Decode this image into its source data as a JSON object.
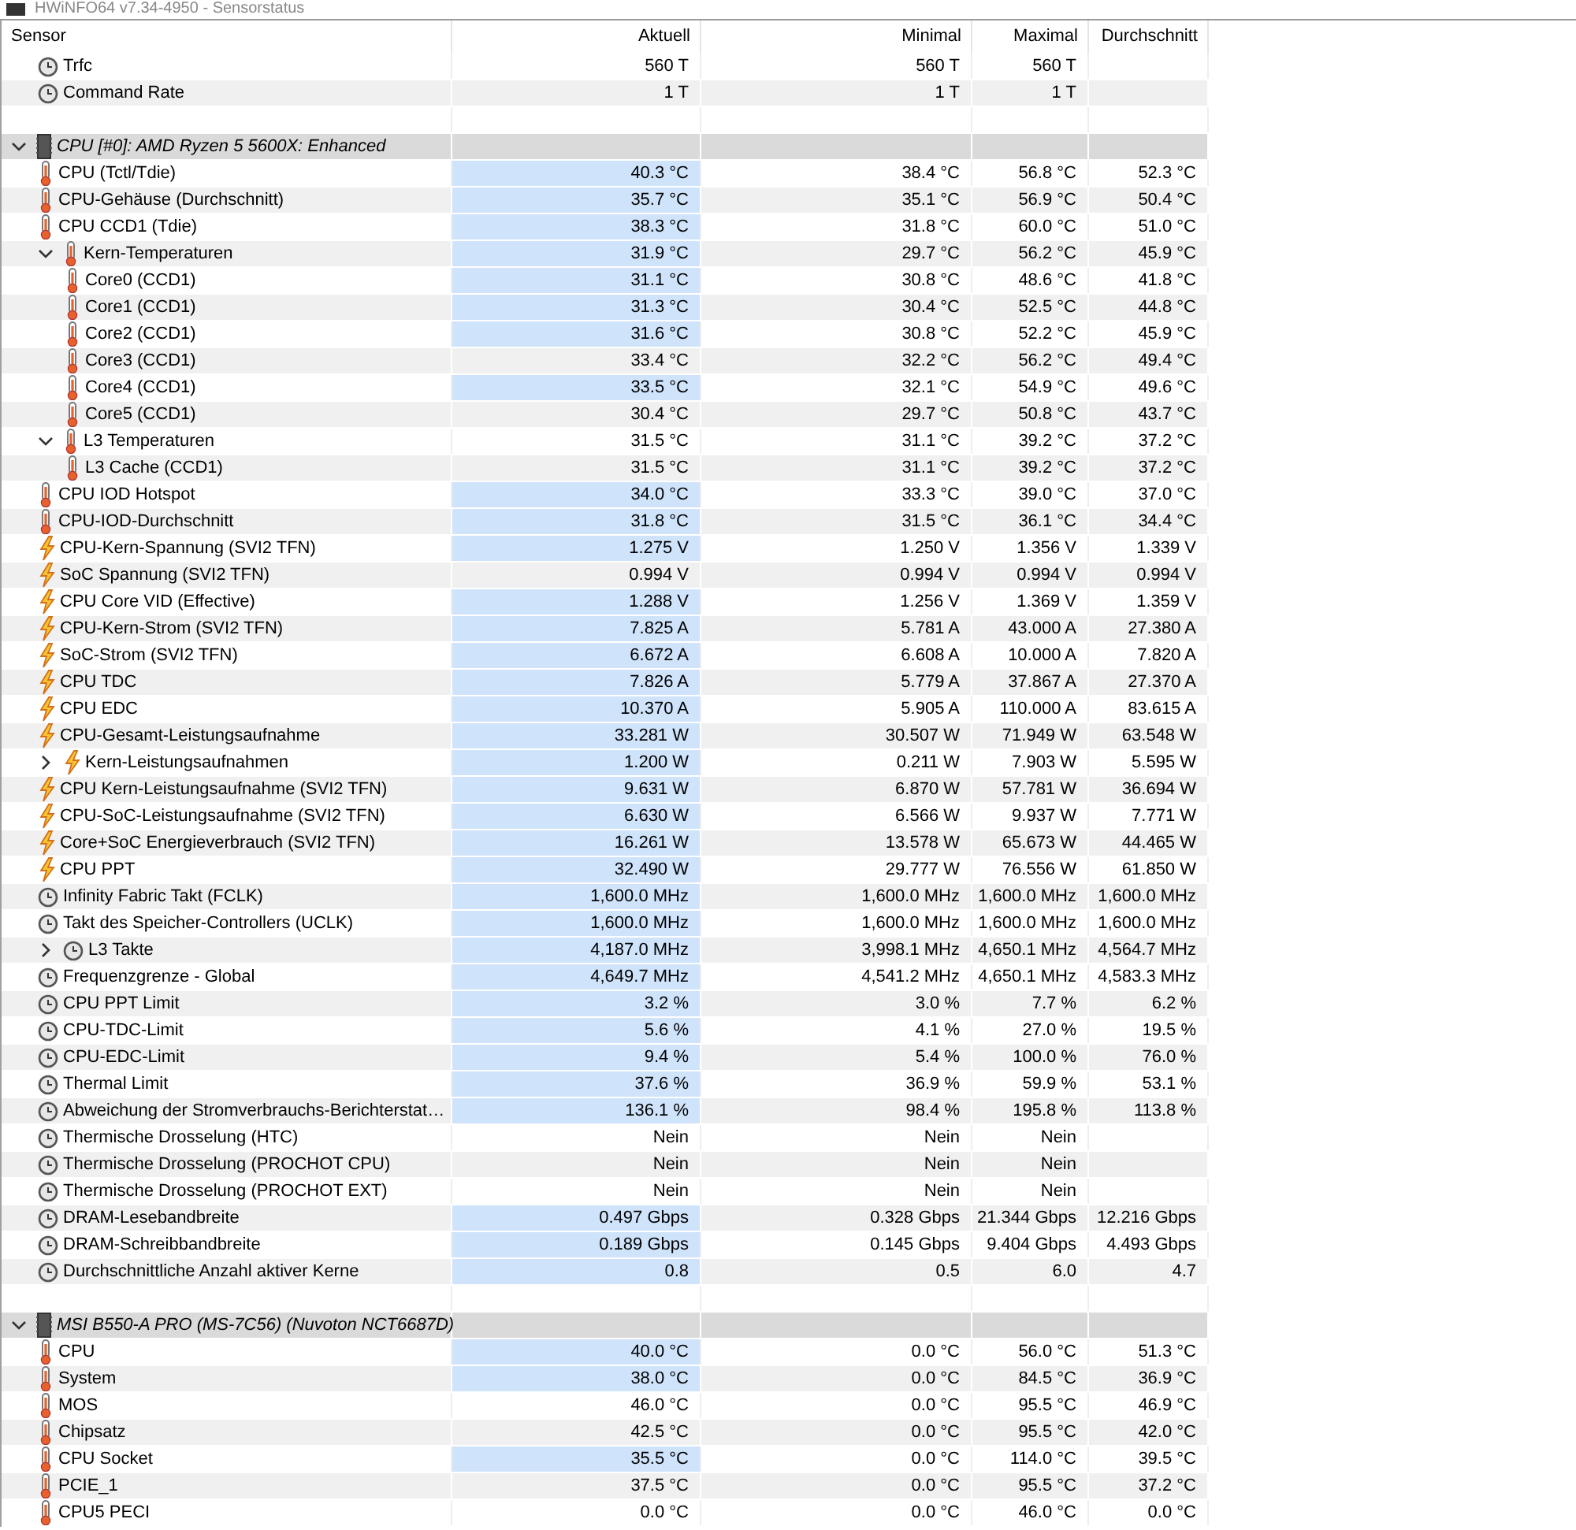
{
  "window": {
    "title": "HWiNFO64 v7.34-4950 - Sensorstatus"
  },
  "table": {
    "columns": [
      "Sensor",
      "Aktuell",
      "Minimal",
      "Maximal",
      "Durchschnitt"
    ],
    "rows": [
      {
        "kind": "clock",
        "name": "Trfc",
        "now": "560 T",
        "min": "560 T",
        "max": "560 T",
        "highlighted": false
      },
      {
        "kind": "clock",
        "name": "Command Rate",
        "now": "1 T",
        "min": "1 T",
        "max": "1 T",
        "highlighted": false
      },
      {
        "kind": "blank"
      },
      {
        "kind": "device",
        "name": "CPU [#0]: AMD Ryzen 5 5600X: Enhanced",
        "expanded": true,
        "children": [
          {
            "kind": "thermo",
            "name": "CPU (Tctl/Tdie)",
            "now": "40.3 °C",
            "min": "38.4 °C",
            "max": "56.8 °C",
            "avg": "52.3 °C",
            "highlighted": true
          },
          {
            "kind": "thermo",
            "name": "CPU-Gehäuse (Durchschnitt)",
            "now": "35.7 °C",
            "min": "35.1 °C",
            "max": "56.9 °C",
            "avg": "50.4 °C",
            "highlighted": true
          },
          {
            "kind": "thermo",
            "name": "CPU CCD1 (Tdie)",
            "now": "38.3 °C",
            "min": "31.8 °C",
            "max": "60.0 °C",
            "avg": "51.0 °C",
            "highlighted": true
          },
          {
            "kind": "thermo",
            "name": "Kern-Temperaturen",
            "now": "31.9 °C",
            "min": "29.7 °C",
            "max": "56.2 °C",
            "avg": "45.9 °C",
            "highlighted": true,
            "expanded": true,
            "children": [
              {
                "kind": "thermo",
                "name": "Core0 (CCD1)",
                "now": "31.1 °C",
                "min": "30.8 °C",
                "max": "48.6 °C",
                "avg": "41.8 °C",
                "highlighted": true
              },
              {
                "kind": "thermo",
                "name": "Core1 (CCD1)",
                "now": "31.3 °C",
                "min": "30.4 °C",
                "max": "52.5 °C",
                "avg": "44.8 °C",
                "highlighted": true
              },
              {
                "kind": "thermo",
                "name": "Core2 (CCD1)",
                "now": "31.6 °C",
                "min": "30.8 °C",
                "max": "52.2 °C",
                "avg": "45.9 °C",
                "highlighted": true
              },
              {
                "kind": "thermo",
                "name": "Core3 (CCD1)",
                "now": "33.4 °C",
                "min": "32.2 °C",
                "max": "56.2 °C",
                "avg": "49.4 °C",
                "highlighted": false
              },
              {
                "kind": "thermo",
                "name": "Core4 (CCD1)",
                "now": "33.5 °C",
                "min": "32.1 °C",
                "max": "54.9 °C",
                "avg": "49.6 °C",
                "highlighted": true
              },
              {
                "kind": "thermo",
                "name": "Core5 (CCD1)",
                "now": "30.4 °C",
                "min": "29.7 °C",
                "max": "50.8 °C",
                "avg": "43.7 °C",
                "highlighted": false
              }
            ]
          },
          {
            "kind": "thermo",
            "name": "L3 Temperaturen",
            "now": "31.5 °C",
            "min": "31.1 °C",
            "max": "39.2 °C",
            "avg": "37.2 °C",
            "highlighted": false,
            "expanded": true,
            "children": [
              {
                "kind": "thermo",
                "name": "L3 Cache (CCD1)",
                "now": "31.5 °C",
                "min": "31.1 °C",
                "max": "39.2 °C",
                "avg": "37.2 °C",
                "highlighted": false
              }
            ]
          },
          {
            "kind": "thermo",
            "name": "CPU IOD Hotspot",
            "now": "34.0 °C",
            "min": "33.3 °C",
            "max": "39.0 °C",
            "avg": "37.0 °C",
            "highlighted": true
          },
          {
            "kind": "thermo",
            "name": "CPU-IOD-Durchschnitt",
            "now": "31.8 °C",
            "min": "31.5 °C",
            "max": "36.1 °C",
            "avg": "34.4 °C",
            "highlighted": true
          },
          {
            "kind": "power",
            "name": "CPU-Kern-Spannung (SVI2 TFN)",
            "now": "1.275 V",
            "min": "1.250 V",
            "max": "1.356 V",
            "avg": "1.339 V",
            "highlighted": true
          },
          {
            "kind": "power",
            "name": "SoC Spannung (SVI2 TFN)",
            "now": "0.994 V",
            "min": "0.994 V",
            "max": "0.994 V",
            "avg": "0.994 V",
            "highlighted": false
          },
          {
            "kind": "power",
            "name": "CPU Core VID (Effective)",
            "now": "1.288 V",
            "min": "1.256 V",
            "max": "1.369 V",
            "avg": "1.359 V",
            "highlighted": true
          },
          {
            "kind": "power",
            "name": "CPU-Kern-Strom (SVI2 TFN)",
            "now": "7.825 A",
            "min": "5.781 A",
            "max": "43.000 A",
            "avg": "27.380 A",
            "highlighted": true
          },
          {
            "kind": "power",
            "name": "SoC-Strom (SVI2 TFN)",
            "now": "6.672 A",
            "min": "6.608 A",
            "max": "10.000 A",
            "avg": "7.820 A",
            "highlighted": true
          },
          {
            "kind": "power",
            "name": "CPU TDC",
            "now": "7.826 A",
            "min": "5.779 A",
            "max": "37.867 A",
            "avg": "27.370 A",
            "highlighted": true
          },
          {
            "kind": "power",
            "name": "CPU EDC",
            "now": "10.370 A",
            "min": "5.905 A",
            "max": "110.000 A",
            "avg": "83.615 A",
            "highlighted": true
          },
          {
            "kind": "power",
            "name": "CPU-Gesamt-Leistungsaufnahme",
            "now": "33.281 W",
            "min": "30.507 W",
            "max": "71.949 W",
            "avg": "63.548 W",
            "highlighted": true
          },
          {
            "kind": "power",
            "name": "Kern-Leistungsaufnahmen",
            "now": "1.200 W",
            "min": "0.211 W",
            "max": "7.903 W",
            "avg": "5.595 W",
            "highlighted": true,
            "expanded": false
          },
          {
            "kind": "power",
            "name": "CPU Kern-Leistungsaufnahme (SVI2 TFN)",
            "now": "9.631 W",
            "min": "6.870 W",
            "max": "57.781 W",
            "avg": "36.694 W",
            "highlighted": true
          },
          {
            "kind": "power",
            "name": "CPU-SoC-Leistungsaufnahme (SVI2 TFN)",
            "now": "6.630 W",
            "min": "6.566 W",
            "max": "9.937 W",
            "avg": "7.771 W",
            "highlighted": true
          },
          {
            "kind": "power",
            "name": "Core+SoC Energieverbrauch (SVI2 TFN)",
            "now": "16.261 W",
            "min": "13.578 W",
            "max": "65.673 W",
            "avg": "44.465 W",
            "highlighted": true
          },
          {
            "kind": "power",
            "name": "CPU PPT",
            "now": "32.490 W",
            "min": "29.777 W",
            "max": "76.556 W",
            "avg": "61.850 W",
            "highlighted": true
          },
          {
            "kind": "clock",
            "name": "Infinity Fabric Takt (FCLK)",
            "now": "1,600.0 MHz",
            "min": "1,600.0 MHz",
            "max": "1,600.0 MHz",
            "avg": "1,600.0 MHz",
            "highlighted": true
          },
          {
            "kind": "clock",
            "name": "Takt des Speicher-Controllers (UCLK)",
            "now": "1,600.0 MHz",
            "min": "1,600.0 MHz",
            "max": "1,600.0 MHz",
            "avg": "1,600.0 MHz",
            "highlighted": true
          },
          {
            "kind": "clock",
            "name": "L3 Takte",
            "now": "4,187.0 MHz",
            "min": "3,998.1 MHz",
            "max": "4,650.1 MHz",
            "avg": "4,564.7 MHz",
            "highlighted": true,
            "expanded": false
          },
          {
            "kind": "clock",
            "name": "Frequenzgrenze - Global",
            "now": "4,649.7 MHz",
            "min": "4,541.2 MHz",
            "max": "4,650.1 MHz",
            "avg": "4,583.3 MHz",
            "highlighted": true
          },
          {
            "kind": "clock",
            "name": "CPU PPT Limit",
            "now": "3.2 %",
            "min": "3.0 %",
            "max": "7.7 %",
            "avg": "6.2 %",
            "highlighted": true
          },
          {
            "kind": "clock",
            "name": "CPU-TDC-Limit",
            "now": "5.6 %",
            "min": "4.1 %",
            "max": "27.0 %",
            "avg": "19.5 %",
            "highlighted": true
          },
          {
            "kind": "clock",
            "name": "CPU-EDC-Limit",
            "now": "9.4 %",
            "min": "5.4 %",
            "max": "100.0 %",
            "avg": "76.0 %",
            "highlighted": true
          },
          {
            "kind": "clock",
            "name": "Thermal Limit",
            "now": "37.6 %",
            "min": "36.9 %",
            "max": "59.9 %",
            "avg": "53.1 %",
            "highlighted": true
          },
          {
            "kind": "clock",
            "name": "Abweichung der Stromverbrauchs-Berichterstat…",
            "now": "136.1 %",
            "min": "98.4 %",
            "max": "195.8 %",
            "avg": "113.8 %",
            "highlighted": true
          },
          {
            "kind": "clock",
            "name": "Thermische Drosselung (HTC)",
            "now": "Nein",
            "min": "Nein",
            "max": "Nein",
            "highlighted": false
          },
          {
            "kind": "clock",
            "name": "Thermische Drosselung (PROCHOT CPU)",
            "now": "Nein",
            "min": "Nein",
            "max": "Nein",
            "highlighted": false
          },
          {
            "kind": "clock",
            "name": "Thermische Drosselung (PROCHOT EXT)",
            "now": "Nein",
            "min": "Nein",
            "max": "Nein",
            "highlighted": false
          },
          {
            "kind": "clock",
            "name": "DRAM-Lesebandbreite",
            "now": "0.497 Gbps",
            "min": "0.328 Gbps",
            "max": "21.344 Gbps",
            "avg": "12.216 Gbps",
            "highlighted": true
          },
          {
            "kind": "clock",
            "name": "DRAM-Schreibbandbreite",
            "now": "0.189 Gbps",
            "min": "0.145 Gbps",
            "max": "9.404 Gbps",
            "avg": "4.493 Gbps",
            "highlighted": true
          },
          {
            "kind": "clock",
            "name": "Durchschnittliche Anzahl aktiver Kerne",
            "now": "0.8",
            "min": "0.5",
            "max": "6.0",
            "avg": "4.7",
            "highlighted": true
          }
        ]
      },
      {
        "kind": "blank"
      },
      {
        "kind": "device",
        "name": "MSI B550-A PRO (MS-7C56) (Nuvoton NCT6687D)",
        "expanded": true,
        "children": [
          {
            "kind": "thermo",
            "name": "CPU",
            "now": "40.0 °C",
            "min": "0.0 °C",
            "max": "56.0 °C",
            "avg": "51.3 °C",
            "highlighted": true
          },
          {
            "kind": "thermo",
            "name": "System",
            "now": "38.0 °C",
            "min": "0.0 °C",
            "max": "84.5 °C",
            "avg": "36.9 °C",
            "highlighted": true
          },
          {
            "kind": "thermo",
            "name": "MOS",
            "now": "46.0 °C",
            "min": "0.0 °C",
            "max": "95.5 °C",
            "avg": "46.9 °C",
            "highlighted": false
          },
          {
            "kind": "thermo",
            "name": "Chipsatz",
            "now": "42.5 °C",
            "min": "0.0 °C",
            "max": "95.5 °C",
            "avg": "42.0 °C",
            "highlighted": false
          },
          {
            "kind": "thermo",
            "name": "CPU Socket",
            "now": "35.5 °C",
            "min": "0.0 °C",
            "max": "114.0 °C",
            "avg": "39.5 °C",
            "highlighted": true
          },
          {
            "kind": "thermo",
            "name": "PCIE_1",
            "now": "37.5 °C",
            "min": "0.0 °C",
            "max": "95.5 °C",
            "avg": "37.2 °C",
            "highlighted": false
          },
          {
            "kind": "thermo",
            "name": "CPU5 PECI",
            "now": "0.0 °C",
            "min": "0.0 °C",
            "max": "46.0 °C",
            "avg": "0.0 °C",
            "highlighted": false
          }
        ]
      }
    ]
  }
}
